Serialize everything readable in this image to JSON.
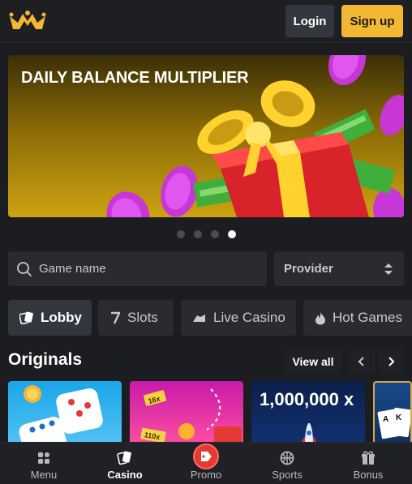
{
  "header": {
    "login_label": "Login",
    "signup_label": "Sign up",
    "brand_color": "#f4b733"
  },
  "banner": {
    "title": "DAILY BALANCE MULTIPLIER",
    "slide_count": 4,
    "active_slide": 4
  },
  "search": {
    "placeholder": "Game name"
  },
  "provider": {
    "label": "Provider"
  },
  "tabs": [
    {
      "label": "Lobby",
      "icon": "cards-icon",
      "active": true
    },
    {
      "label": "Slots",
      "icon": "seven-icon",
      "active": false
    },
    {
      "label": "Live Casino",
      "icon": "dealer-hand-icon",
      "active": false
    },
    {
      "label": "Hot Games",
      "icon": "flame-icon",
      "active": false
    }
  ],
  "originals": {
    "title": "Originals",
    "view_all_label": "View all",
    "cards": [
      {
        "name": "dice-game-card"
      },
      {
        "name": "plinko-game-card",
        "tag_1": "16x",
        "tag_2": "110x"
      },
      {
        "name": "crash-game-card",
        "text": "1,000,000 x"
      },
      {
        "name": "cards-game-card"
      }
    ]
  },
  "bottom_nav": {
    "items": [
      {
        "label": "Menu",
        "icon": "grid-icon"
      },
      {
        "label": "Casino",
        "icon": "cards-icon",
        "active": true
      },
      {
        "label": "Promo",
        "icon": "gift-tag-icon"
      },
      {
        "label": "Sports",
        "icon": "ball-icon"
      },
      {
        "label": "Bonus",
        "icon": "gift-icon"
      }
    ]
  }
}
